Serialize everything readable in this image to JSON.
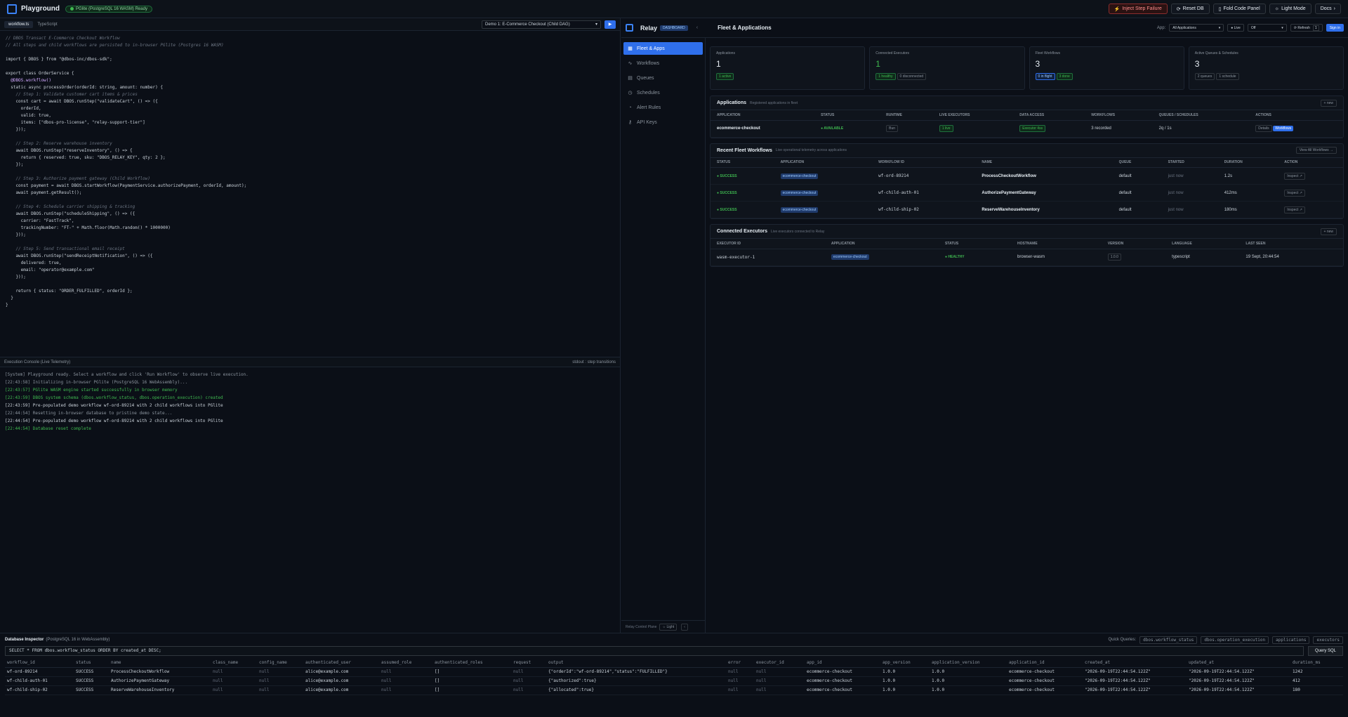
{
  "topbar": {
    "title": "Playground",
    "status": "PGlite (PostgreSQL 16 WASM) Ready",
    "buttons": [
      "Inject Step Failure",
      "Reset DB",
      "Fold Code Panel",
      "Light Mode",
      "Docs"
    ]
  },
  "editor": {
    "tabs": [
      "workflow.ts",
      "TypeScript"
    ],
    "demo": "Demo 1: E-Commerce Checkout (Child DAG)",
    "lines": [
      {
        "t": "// DBOS Transact E-Commerce Checkout Workflow",
        "c": "c"
      },
      {
        "t": "// All steps and child workflows are persisted to in-browser PGlite (Postgres 16 WASM)",
        "c": "c"
      },
      {
        "t": "",
        "c": ""
      },
      {
        "t": "import { DBOS } from \"@dbos-inc/dbos-sdk\";",
        "c": ""
      },
      {
        "t": "",
        "c": ""
      },
      {
        "t": "export class OrderService {",
        "c": ""
      },
      {
        "t": "  @DBOS.workflow()",
        "c": "k"
      },
      {
        "t": "  static async processOrder(orderId: string, amount: number) {",
        "c": ""
      },
      {
        "t": "    // Step 1: Validate customer cart items & prices",
        "c": "c"
      },
      {
        "t": "    const cart = await DBOS.runStep(\"validateCart\", () => ({",
        "c": ""
      },
      {
        "t": "      orderId,",
        "c": ""
      },
      {
        "t": "      valid: true,",
        "c": ""
      },
      {
        "t": "      items: [\"dbos-pro-license\", \"relay-support-tier\"]",
        "c": ""
      },
      {
        "t": "    }));",
        "c": ""
      },
      {
        "t": "",
        "c": ""
      },
      {
        "t": "    // Step 2: Reserve warehouse inventory",
        "c": "c"
      },
      {
        "t": "    await DBOS.runStep(\"reserveInventory\", () => {",
        "c": ""
      },
      {
        "t": "      return { reserved: true, sku: \"DBOS_RELAY_KEY\", qty: 2 };",
        "c": ""
      },
      {
        "t": "    });",
        "c": ""
      },
      {
        "t": "",
        "c": ""
      },
      {
        "t": "    // Step 3: Authorize payment gateway (Child Workflow)",
        "c": "c"
      },
      {
        "t": "    const payment = await DBOS.startWorkflow(PaymentService.authorizePayment, orderId, amount);",
        "c": ""
      },
      {
        "t": "    await payment.getResult();",
        "c": ""
      },
      {
        "t": "",
        "c": ""
      },
      {
        "t": "    // Step 4: Schedule carrier shipping & tracking",
        "c": "c"
      },
      {
        "t": "    await DBOS.runStep(\"scheduleShipping\", () => ({",
        "c": ""
      },
      {
        "t": "      carrier: \"FastTrack\",",
        "c": ""
      },
      {
        "t": "      trackingNumber: \"FT-\" + Math.floor(Math.random() * 1000000)",
        "c": ""
      },
      {
        "t": "    }));",
        "c": ""
      },
      {
        "t": "",
        "c": ""
      },
      {
        "t": "    // Step 5: Send transactional email receipt",
        "c": "c"
      },
      {
        "t": "    await DBOS.runStep(\"sendReceiptNotification\", () => ({",
        "c": ""
      },
      {
        "t": "      delivered: true,",
        "c": ""
      },
      {
        "t": "      email: \"operator@example.com\"",
        "c": ""
      },
      {
        "t": "    }));",
        "c": ""
      },
      {
        "t": "",
        "c": ""
      },
      {
        "t": "    return { status: \"ORDER_FULFILLED\", orderId };",
        "c": ""
      },
      {
        "t": "  }",
        "c": ""
      },
      {
        "t": "}",
        "c": ""
      }
    ]
  },
  "console": {
    "title": "Execution Console (Live Telemetry)",
    "right": "stdout : step transitions",
    "lines": [
      {
        "t": "[System] Playground ready. Select a workflow and click 'Run Workflow' to observe live execution.",
        "color": "#8b949e"
      },
      {
        "t": "[22:43:58] Initializing in-browser PGlite (PostgreSQL 16 WebAssembly)...",
        "color": "#8b949e"
      },
      {
        "t": "[22:43:57] PGlite WASM engine started successfully in browser memory",
        "color": "#3fb950"
      },
      {
        "t": "[22:43:59] DBOS system schema (dbos.workflow_status, dbos.operation_execution) created",
        "color": "#3fb950"
      },
      {
        "t": "[22:43:59] Pre-populated demo workflow wf-ord-89214 with 2 child workflows into PGlite",
        "color": "#c9d1d9"
      },
      {
        "t": "[22:44:54] Resetting in-browser database to pristine demo state...",
        "color": "#8b949e"
      },
      {
        "t": "[22:44:54] Pre-populated demo workflow wf-ord-89214 with 2 child workflows into PGlite",
        "color": "#c9d1d9"
      },
      {
        "t": "[22:44:54] Database reset complete",
        "color": "#3fb950"
      }
    ]
  },
  "relay": {
    "name": "Relay",
    "badge": "DASHBOARD",
    "page_title": "Fleet & Applications",
    "app_label": "App:",
    "app_value": "All Applications",
    "live_label": "Live",
    "off_value": "Off",
    "refresh": "Refresh",
    "refresh_count": "1",
    "signin": "Sign in",
    "nav": [
      "Fleet & Apps",
      "Workflows",
      "Queues",
      "Schedules",
      "Alert Rules",
      "API Keys"
    ],
    "footer": "Relay Control Plane",
    "footer_mode": "Light",
    "stats": [
      {
        "label": "Applications",
        "value": "1",
        "chips": [
          {
            "t": "1 active",
            "k": "g"
          }
        ]
      },
      {
        "label": "Connected Executors",
        "value": "1",
        "green": true,
        "chips": [
          {
            "t": "1 healthy",
            "k": "g"
          },
          {
            "t": "0 disconnected",
            "k": ""
          }
        ]
      },
      {
        "label": "Fleet Workflows",
        "value": "3",
        "chips": [
          {
            "t": "0 in flight",
            "k": "b"
          },
          {
            "t": "3 done",
            "k": "g"
          }
        ]
      },
      {
        "label": "Active Queues & Schedules",
        "value": "3",
        "chips": [
          {
            "t": "2 queues",
            "k": ""
          },
          {
            "t": "1 schedule",
            "k": ""
          }
        ]
      }
    ],
    "applications": {
      "title": "Applications",
      "subtitle": "Registered applications in fleet",
      "btn": "+ new",
      "cols": [
        "APPLICATION",
        "STATUS",
        "RUNTIME",
        "LIVE EXECUTORS",
        "DATA ACCESS",
        "WORKFLOWS",
        "QUEUES / SCHEDULES",
        "ACTIONS"
      ],
      "row": {
        "app": "ecommerce-checkout",
        "status": "AVAILABLE",
        "runtime": "Bun",
        "live": "1 live",
        "access": "Executor 4ss",
        "workflows": "3 recorded",
        "queues": "2q / 1s",
        "details": "Details",
        "workflows_btn": "Workflows"
      }
    },
    "recent": {
      "title": "Recent Fleet Workflows",
      "subtitle": "Live operational telemetry across applications",
      "btn": "View All Workflows →",
      "cols": [
        "STATUS",
        "APPLICATION",
        "WORKFLOW ID",
        "NAME",
        "QUEUE",
        "STARTED",
        "DURATION",
        "ACTION"
      ],
      "rows": [
        {
          "status": "SUCCESS",
          "app": "ecommerce-checkout",
          "id": "wf-ord-89214",
          "name": "ProcessCheckoutWorkflow",
          "queue": "default",
          "started": "just now",
          "duration": "1.2s",
          "action": "Inspect ↗"
        },
        {
          "status": "SUCCESS",
          "app": "ecommerce-checkout",
          "id": "wf-child-auth-01",
          "name": "AuthorizePaymentGateway",
          "queue": "default",
          "started": "just now",
          "duration": "412ms",
          "action": "Inspect ↗"
        },
        {
          "status": "SUCCESS",
          "app": "ecommerce-checkout",
          "id": "wf-child-ship-02",
          "name": "ReserveWarehouseInventory",
          "queue": "default",
          "started": "just now",
          "duration": "180ms",
          "action": "Inspect ↗"
        }
      ]
    },
    "executors": {
      "title": "Connected Executors",
      "subtitle": "Live executors connected to Relay",
      "btn": "+ new",
      "cols": [
        "EXECUTOR ID",
        "APPLICATION",
        "STATUS",
        "HOSTNAME",
        "VERSION",
        "LANGUAGE",
        "LAST SEEN"
      ],
      "row": {
        "id": "wasm-executor-1",
        "app": "ecommerce-checkout",
        "status": "HEALTHY",
        "host": "browser-wasm",
        "version": "1.0.0",
        "lang": "typescript",
        "seen": "19 Sept, 20:44:54"
      }
    }
  },
  "db": {
    "title": "Database Inspector",
    "subtitle": "(PostgreSQL 16 in WebAssembly)",
    "quick_label": "Quick Queries:",
    "quick": [
      "dbos.workflow_status",
      "dbos.operation_execution",
      "applications",
      "executors"
    ],
    "query": "SELECT * FROM dbos.workflow_status ORDER BY created_at DESC;",
    "query_btn": "Query SQL",
    "cols": [
      "workflow_id",
      "status",
      "name",
      "class_name",
      "config_name",
      "authenticated_user",
      "assumed_role",
      "authenticated_roles",
      "request",
      "output",
      "error",
      "executor_id",
      "app_id",
      "app_version",
      "application_version",
      "application_id",
      "created_at",
      "updated_at",
      "duration_ms"
    ],
    "rows": [
      [
        "wf-ord-89214",
        "SUCCESS",
        "ProcessCheckoutWorkflow",
        "null",
        "null",
        "alice@example.com",
        "null",
        "[]",
        "null",
        "{\"orderId\":\"wf-ord-89214\",\"status\":\"FULFILLED\"}",
        "null",
        "null",
        "ecommerce-checkout",
        "1.0.0",
        "1.0.0",
        "ecommerce-checkout",
        "\"2026-09-19T22:44:54.122Z\"",
        "\"2026-09-19T22:44:54.122Z\"",
        "1242"
      ],
      [
        "wf-child-auth-01",
        "SUCCESS",
        "AuthorizePaymentGateway",
        "null",
        "null",
        "alice@example.com",
        "null",
        "[]",
        "null",
        "{\"authorized\":true}",
        "null",
        "null",
        "ecommerce-checkout",
        "1.0.0",
        "1.0.0",
        "ecommerce-checkout",
        "\"2026-09-19T22:44:54.122Z\"",
        "\"2026-09-19T22:44:54.122Z\"",
        "412"
      ],
      [
        "wf-child-ship-02",
        "SUCCESS",
        "ReserveWarehouseInventory",
        "null",
        "null",
        "alice@example.com",
        "null",
        "[]",
        "null",
        "{\"allocated\":true}",
        "null",
        "null",
        "ecommerce-checkout",
        "1.0.0",
        "1.0.0",
        "ecommerce-checkout",
        "\"2026-09-19T22:44:54.122Z\"",
        "\"2026-09-19T22:44:54.122Z\"",
        "180"
      ]
    ]
  }
}
